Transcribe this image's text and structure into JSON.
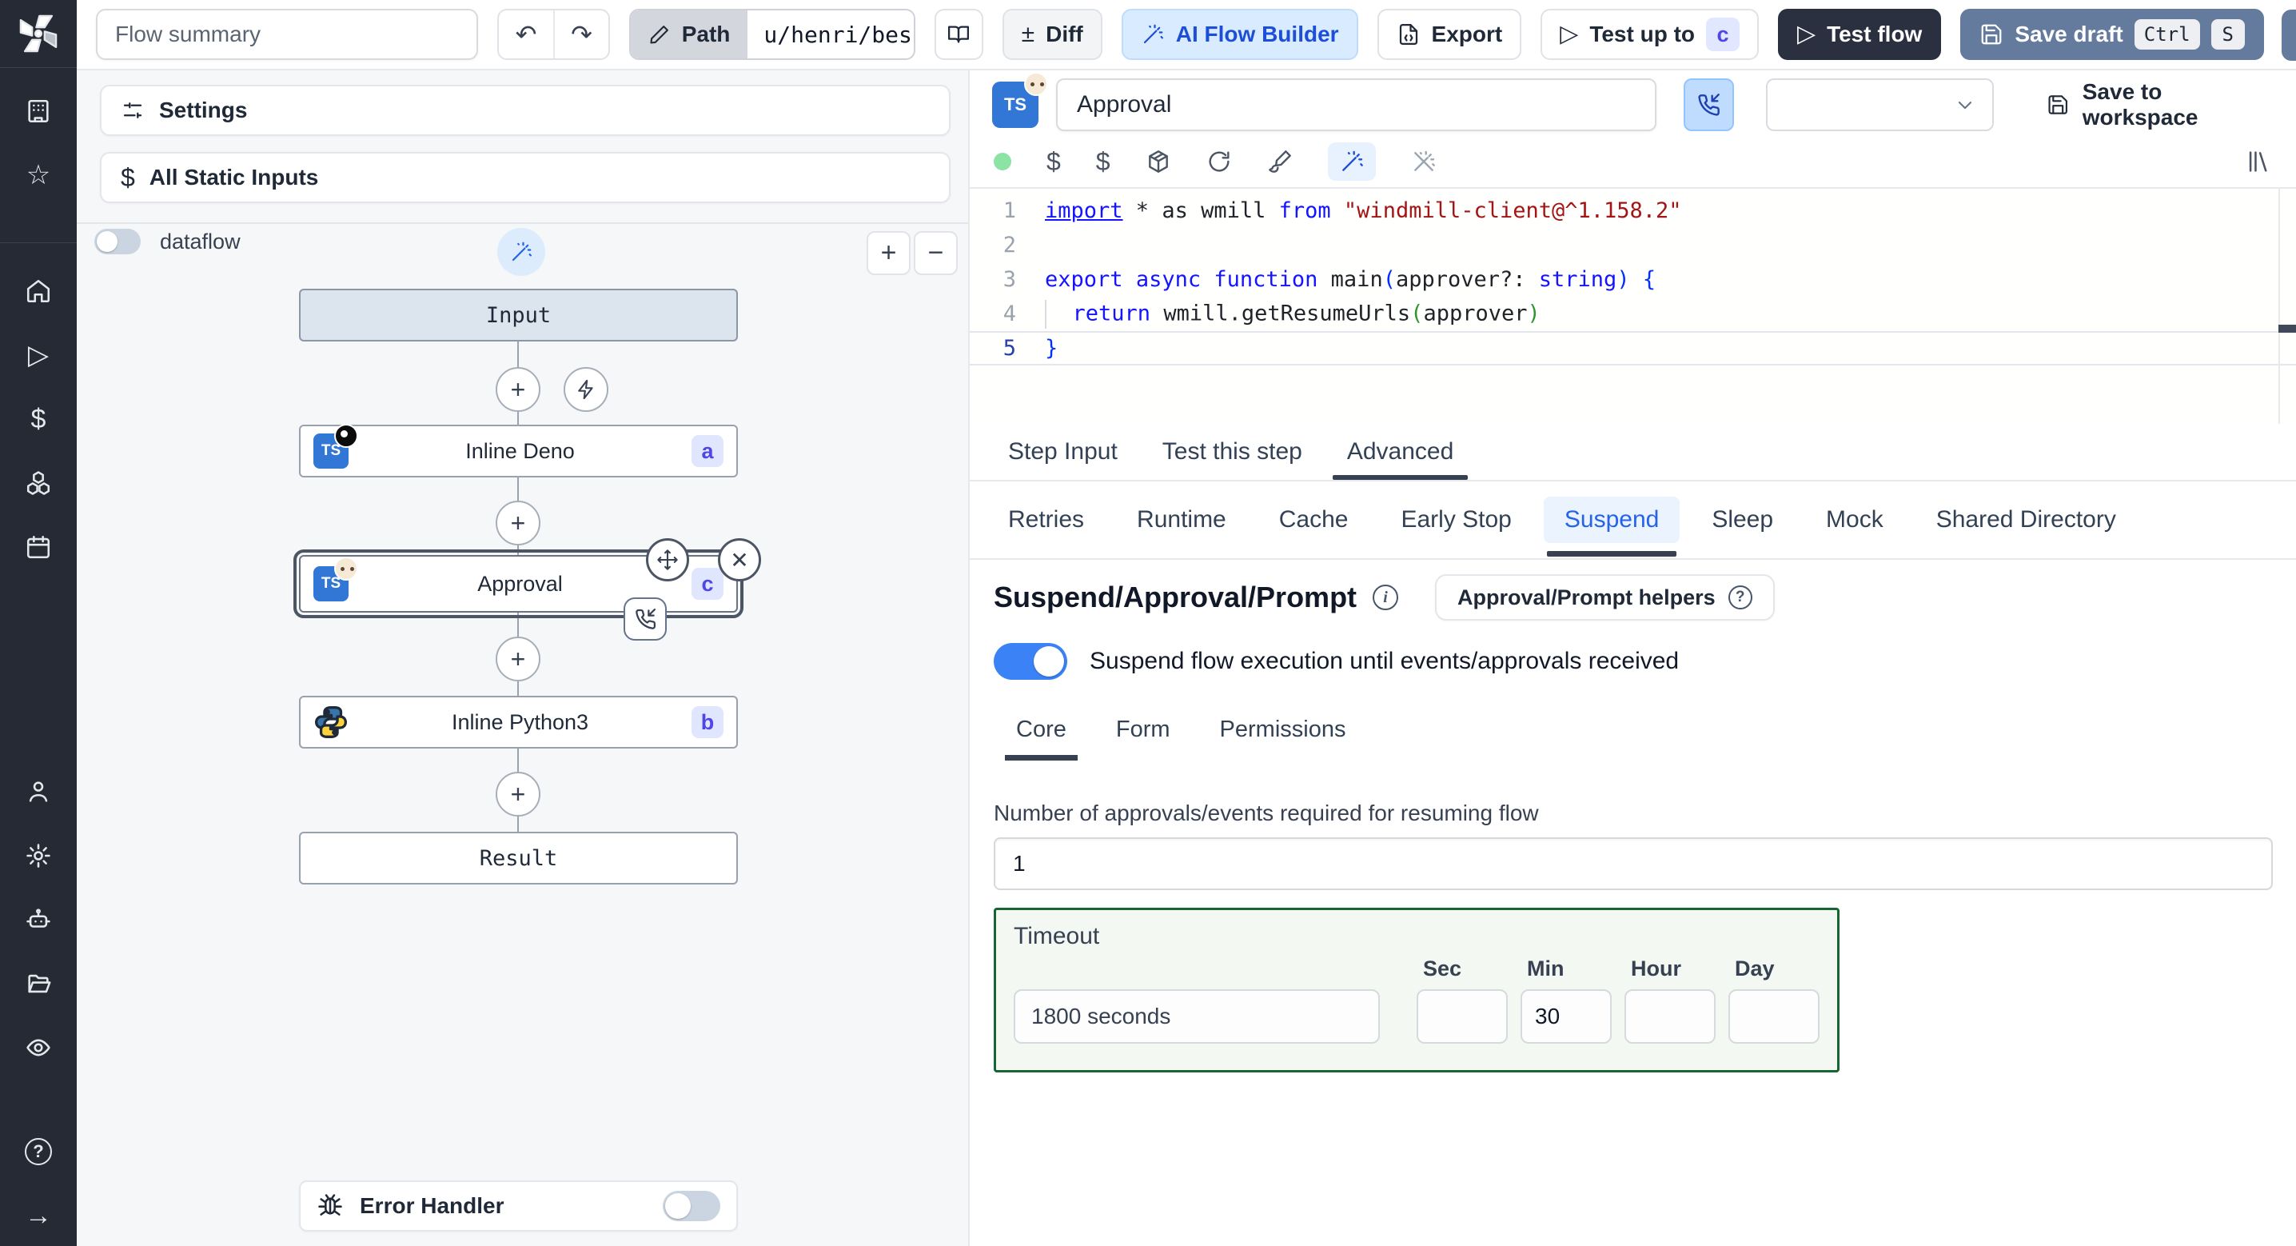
{
  "icons": {
    "dollar": "$",
    "plus": "+",
    "minus": "−",
    "diff": "±",
    "close": "✕",
    "undo": "↶",
    "redo": "↷",
    "arrow_right": "→",
    "refresh": "↻",
    "star": "☆",
    "play_outline": "▷",
    "info": "i",
    "help": "?"
  },
  "colors": {
    "accent_blue": "#3b82f6",
    "badge_text": "#4f46e5",
    "badge_bg": "#e0e7ff",
    "timeout_border": "#166534",
    "status_green": "#8be3a4",
    "test_flow_bg": "#2b3040",
    "save_draft_bg": "#657b9e",
    "sidebar_bg": "#252a35"
  },
  "topbar": {
    "summary_placeholder": "Flow summary",
    "path_label": "Path",
    "path_value": "u/henri/bes",
    "diff_label": "Diff",
    "ai_builder_label": "AI Flow Builder",
    "export_label": "Export",
    "test_up_to_label": "Test up to",
    "test_up_to_step": "c",
    "test_flow_label": "Test flow",
    "save_draft_label": "Save draft",
    "kbd_ctrl": "Ctrl",
    "kbd_s": "S"
  },
  "flow_panel": {
    "settings_label": "Settings",
    "static_inputs_label": "All Static Inputs",
    "dataflow_label": "dataflow",
    "ts_label": "TS",
    "nodes": {
      "input_label": "Input",
      "deno_label": "Inline Deno",
      "deno_badge": "a",
      "approval_label": "Approval",
      "approval_badge": "c",
      "python_label": "Inline Python3",
      "python_badge": "b",
      "result_label": "Result"
    },
    "error_handler_label": "Error Handler"
  },
  "step_panel": {
    "name_value": "Approval",
    "lang_badge": "TS",
    "save_to_workspace_label": "Save to workspace",
    "editor": {
      "lines": [
        {
          "num": "1",
          "tokens": [
            [
              "kwu",
              "import"
            ],
            [
              "pl",
              " * as wmill "
            ],
            [
              "kw",
              "from"
            ],
            [
              "pl",
              " "
            ],
            [
              "str",
              "\"windmill-client@^1.158.2\""
            ]
          ]
        },
        {
          "num": "2",
          "tokens": []
        },
        {
          "num": "3",
          "tokens": [
            [
              "kw",
              "export"
            ],
            [
              "pl",
              " "
            ],
            [
              "kw",
              "async"
            ],
            [
              "pl",
              " "
            ],
            [
              "kw",
              "function"
            ],
            [
              "pl",
              " "
            ],
            [
              "pl",
              "main"
            ],
            [
              "b1",
              "("
            ],
            [
              "pl",
              "approver?: "
            ],
            [
              "kw",
              "string"
            ],
            [
              "b1",
              ")"
            ],
            [
              "pl",
              " "
            ],
            [
              "b1",
              "{"
            ]
          ]
        },
        {
          "num": "4",
          "tokens": [
            [
              "ig",
              ""
            ],
            [
              "pl",
              "  "
            ],
            [
              "kw",
              "return"
            ],
            [
              "pl",
              " wmill.getResumeUrls"
            ],
            [
              "b2",
              "("
            ],
            [
              "pl",
              "approver"
            ],
            [
              "b2",
              ")"
            ]
          ]
        },
        {
          "num": "5",
          "tokens": [
            [
              "b1",
              "}"
            ]
          ],
          "active": true
        }
      ]
    },
    "tabs": [
      "Step Input",
      "Test this step",
      "Advanced"
    ],
    "active_tab": "Advanced",
    "subtabs": [
      "Retries",
      "Runtime",
      "Cache",
      "Early Stop",
      "Suspend",
      "Sleep",
      "Mock",
      "Shared Directory"
    ],
    "active_subtab": "Suspend",
    "suspend": {
      "title": "Suspend/Approval/Prompt",
      "helpers_label": "Approval/Prompt helpers",
      "toggle_label": "Suspend flow execution until events/approvals received",
      "toggle_on": true,
      "tabs": [
        "Core",
        "Form",
        "Permissions"
      ],
      "active_tab": "Core",
      "approvals_label": "Number of approvals/events required for resuming flow",
      "approvals_value": "1",
      "timeout_label": "Timeout",
      "timeout_value": "1800 seconds",
      "unit_labels": [
        "Sec",
        "Min",
        "Hour",
        "Day"
      ],
      "unit_values": [
        "",
        "30",
        "",
        ""
      ]
    }
  }
}
